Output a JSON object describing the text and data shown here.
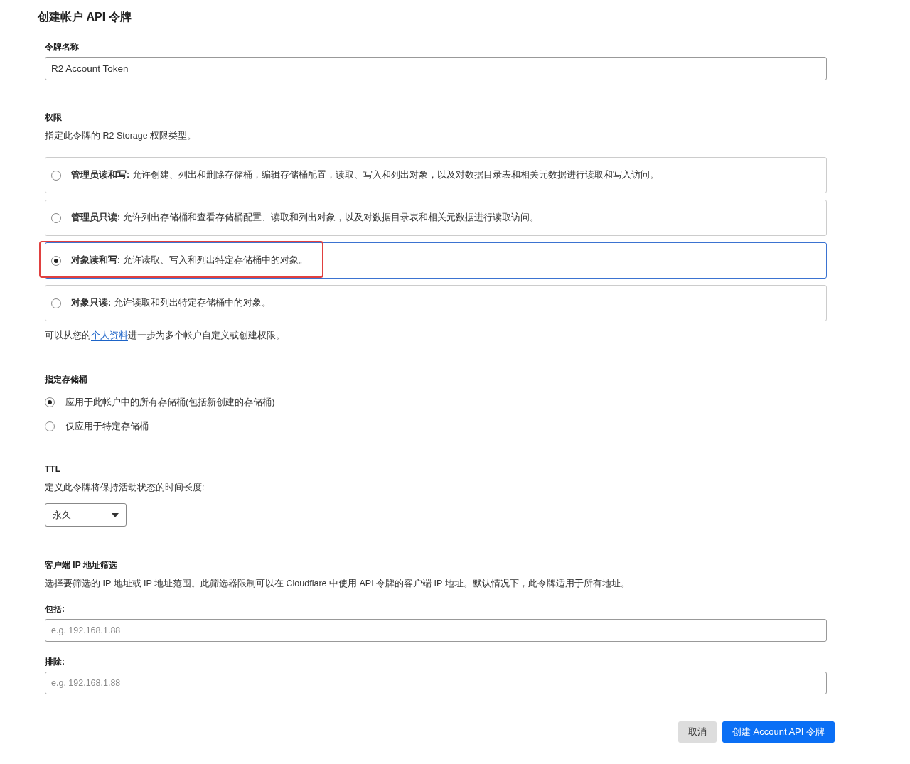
{
  "title": "创建帐户 API 令牌",
  "token_name": {
    "label": "令牌名称",
    "value": "R2 Account Token"
  },
  "permissions": {
    "heading": "权限",
    "description": "指定此令牌的 R2 Storage 权限类型。",
    "options": [
      {
        "text": "**管理员读和写:** 允许创建、列出和删除存储桶，编辑存储桶配置，读取、写入和列出对象，以及对数据目录表和相关元数据进行读取和写入访问。",
        "selected": false,
        "highlighted": false
      },
      {
        "text": "**管理员只读:** 允许列出存储桶和查看存储桶配置、读取和列出对象，以及对数据目录表和相关元数据进行读取访问。",
        "selected": false,
        "highlighted": false
      },
      {
        "text": "**对象读和写:** 允许读取、写入和列出特定存储桶中的对象。",
        "selected": true,
        "highlighted": true
      },
      {
        "text": "**对象只读:** 允许读取和列出特定存储桶中的对象。",
        "selected": false,
        "highlighted": false
      }
    ],
    "note_before": "可以从您的",
    "note_link": "个人资料",
    "note_after": "进一步为多个帐户自定义或创建权限。"
  },
  "buckets": {
    "heading": "指定存储桶",
    "options": [
      {
        "label": "应用于此帐户中的所有存储桶(包括新创建的存储桶)",
        "selected": true
      },
      {
        "label": "仅应用于特定存储桶",
        "selected": false
      }
    ]
  },
  "ttl": {
    "heading": "TTL",
    "description": "定义此令牌将保持活动状态的时间长度:",
    "value": "永久"
  },
  "ip_filter": {
    "heading": "客户端 IP 地址筛选",
    "description": "选择要筛选的 IP 地址或 IP 地址范围。此筛选器限制可以在 Cloudflare 中使用 API 令牌的客户端 IP 地址。默认情况下，此令牌适用于所有地址。",
    "include": {
      "label": "包括:",
      "placeholder": "e.g. 192.168.1.88"
    },
    "exclude": {
      "label": "排除:",
      "placeholder": "e.g. 192.168.1.88"
    }
  },
  "buttons": {
    "cancel": "取消",
    "create": "创建 Account API 令牌"
  }
}
